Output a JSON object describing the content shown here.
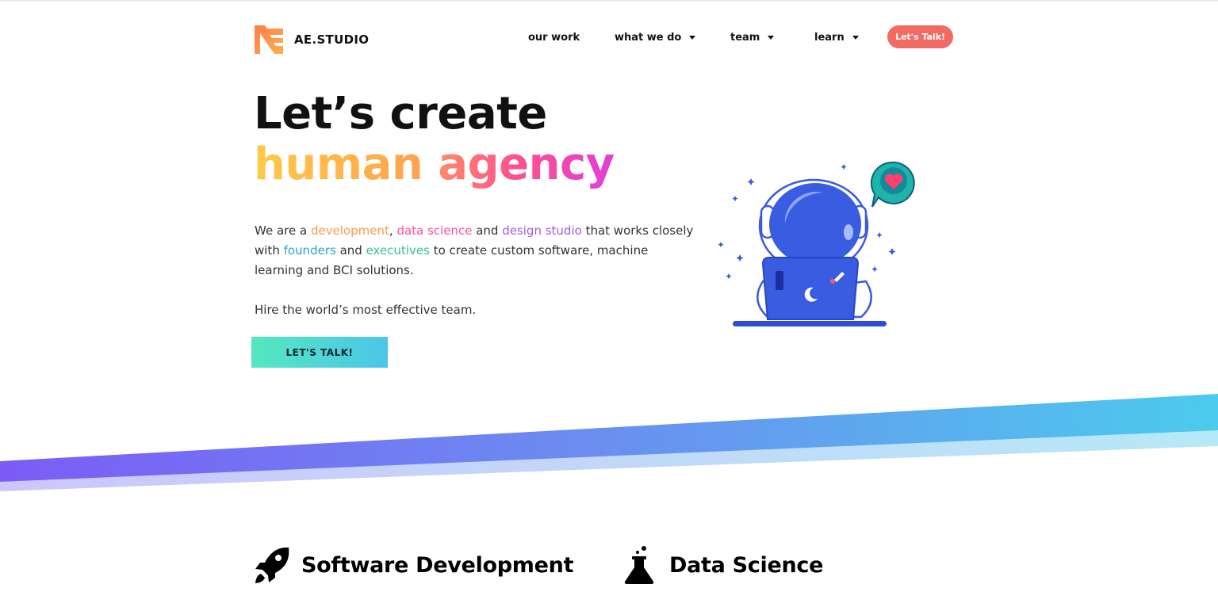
{
  "brand": {
    "name": "AE.STUDIO",
    "colors": {
      "accent": "#f26b63",
      "gradient_start": "#54e7c0",
      "gradient_end": "#4cc6e8"
    }
  },
  "nav": {
    "items": [
      {
        "label": "our work",
        "dropdown": false
      },
      {
        "label": "what we do",
        "dropdown": true
      },
      {
        "label": "team",
        "dropdown": true
      },
      {
        "label": "learn",
        "dropdown": true
      }
    ],
    "cta_label": "Let's Talk!"
  },
  "hero": {
    "title_line1": "Let’s create",
    "title_word1": "human",
    "title_word2": "agency",
    "desc": {
      "p1": "We are a ",
      "development": "development",
      "comma": ", ",
      "data_science": "data science",
      "and1": " and ",
      "design_studio": "design studio",
      "p2": " that works closely with ",
      "founders": "founders",
      "and2": " and ",
      "executives": "executives",
      "p3": " to create custom software, machine learning and BCI solutions."
    },
    "subtext": "Hire the world’s most effective team.",
    "button_label": "LET'S TALK!"
  },
  "services": [
    {
      "title": "Software Development",
      "icon": "rocket-icon"
    },
    {
      "title": "Data Science",
      "icon": "flask-icon"
    }
  ]
}
